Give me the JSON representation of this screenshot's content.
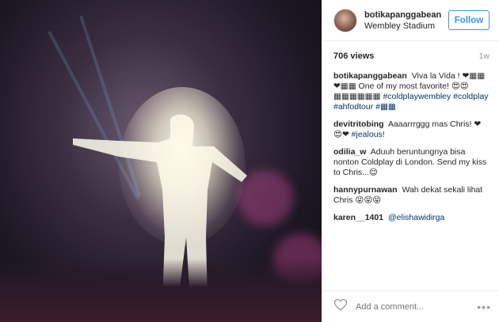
{
  "post": {
    "username": "botikapanggabean",
    "location": "Wembley Stadium",
    "follow_label": "Follow",
    "views": "706 views",
    "age": "1w"
  },
  "caption": {
    "username": "botikapanggabean",
    "text": "Viva la Vida ! ❤▦▦❤▦▦ One of my most favorite! 😍😍▦▦▦▦▦▦",
    "tags": [
      "#coldplaywembley",
      "#coldplay",
      "#ahfodtour",
      "#▦▦"
    ]
  },
  "comments": [
    {
      "username": "devitritobing",
      "text": "Aaaarrrggg mas Chris! ❤😍❤",
      "tag": "#jealous",
      "after": "!"
    },
    {
      "username": "odilia_w",
      "text": "Aduuh beruntungnya bisa nonton Coldplay di London. Send my kiss to Chris...😌"
    },
    {
      "username": "hannypurnawan",
      "text": "Wah dekat sekali lihat Chris 😝😝😝"
    },
    {
      "username": "karen__1401",
      "mention": "@elishawidirga"
    }
  ],
  "footer": {
    "add_comment_placeholder": "Add a comment...",
    "more_label": "•••"
  },
  "icons": {
    "like": "heart-icon",
    "more": "more-options-icon"
  }
}
